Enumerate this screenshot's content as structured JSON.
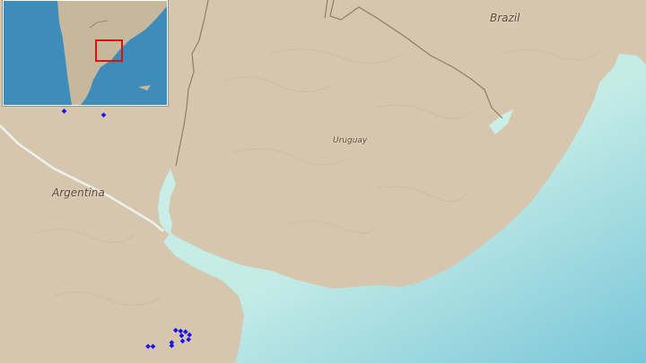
{
  "map": {
    "labels": {
      "brazil": "Brazil",
      "uruguay": "Uruguay",
      "argentina": "Argentina"
    },
    "colors": {
      "land": "#d6c6ae",
      "sea": "#c9ede7",
      "border": "#8c7d6d",
      "marker": "#1a10f0",
      "inset_sea": "#3d8cba",
      "inset_land": "#c6b89c",
      "inset_highlight": "#e01010"
    },
    "occurrence_markers": [
      {
        "lon": -57.9,
        "lat": -30.3
      },
      {
        "lon": -58.0,
        "lat": -30.7
      },
      {
        "lon": -57.99,
        "lat": -31.0
      },
      {
        "lon": -57.55,
        "lat": -31.5
      },
      {
        "lon": -57.15,
        "lat": -31.55
      },
      {
        "lon": -56.42,
        "lat": -34.36
      },
      {
        "lon": -56.37,
        "lat": -34.37
      },
      {
        "lon": -56.32,
        "lat": -34.38
      },
      {
        "lon": -56.28,
        "lat": -34.42
      },
      {
        "lon": -56.29,
        "lat": -34.48
      },
      {
        "lon": -56.35,
        "lat": -34.5
      },
      {
        "lon": -56.36,
        "lat": -34.43
      },
      {
        "lon": -56.46,
        "lat": -34.52
      },
      {
        "lon": -56.46,
        "lat": -34.56
      },
      {
        "lon": -56.7,
        "lat": -34.57
      },
      {
        "lon": -56.65,
        "lat": -34.57
      }
    ],
    "inset": {
      "highlight_region": "Uruguay"
    }
  }
}
